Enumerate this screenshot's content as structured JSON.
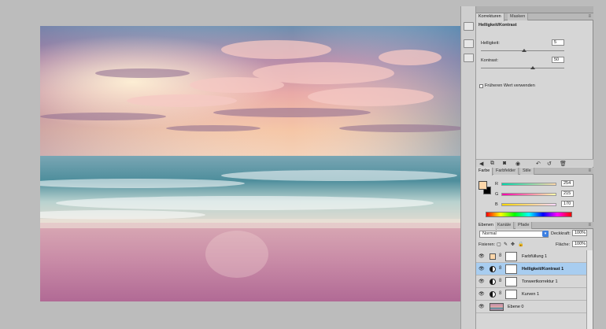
{
  "adjustments_panel": {
    "tabs": [
      "Korrekturen",
      "Masken"
    ],
    "title": "Helligkeit/Kontrast",
    "brightness_label": "Helligkeit:",
    "brightness_value": "5",
    "contrast_label": "Kontrast:",
    "contrast_value": "50",
    "legacy_label": "Früheren Wert verwenden",
    "brightness_level": 0.52,
    "contrast_level": 0.62
  },
  "color_panel": {
    "tabs": [
      "Farbe",
      "Farbfelder",
      "Stile"
    ],
    "r_label": "R",
    "g_label": "G",
    "b_label": "B",
    "r_value": "254",
    "g_value": "215",
    "b_value": "170",
    "foreground_color": "#fed7aa",
    "background_color": "#000000"
  },
  "layers_panel": {
    "tabs": [
      "Ebenen",
      "Kanäle",
      "Pfade"
    ],
    "blend_mode": "Normal",
    "opacity_label": "Deckkraft:",
    "opacity_value": "100%",
    "lock_label": "Fixieren:",
    "fill_label": "Fläche:",
    "fill_value": "100%",
    "layers": [
      {
        "name": "Farbfüllung 1",
        "selected": false
      },
      {
        "name": "Helligkeit/Kontrast 1",
        "selected": true
      },
      {
        "name": "Tonwertkorrektur 1",
        "selected": false
      },
      {
        "name": "Kurven 1",
        "selected": false
      },
      {
        "name": "Ebene 0",
        "selected": false
      }
    ]
  },
  "icons": {
    "visibility": "eye-icon",
    "link": "chain-icon",
    "adjustment": "adjustment-layer-icon",
    "panel_menu": "panel-menu-icon"
  },
  "colors": {
    "selection": "#a8cdf0",
    "accent": "#3d7fe0"
  }
}
